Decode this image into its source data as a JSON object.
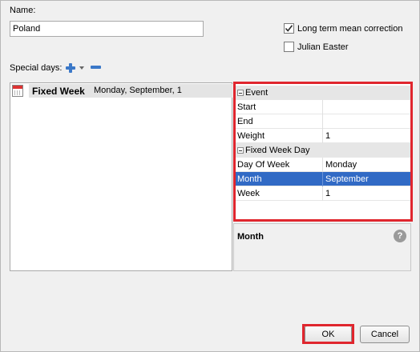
{
  "form": {
    "name_label": "Name:",
    "name_value": "Poland",
    "long_term_label": "Long term mean correction",
    "long_term_checked": true,
    "julian_label": "Julian Easter",
    "julian_checked": false,
    "special_days_label": "Special days:"
  },
  "icons": {
    "add": "plus-icon",
    "add_menu": "chevron-down-icon",
    "remove": "minus-icon",
    "list_item": "calendar-icon",
    "help": "help-icon"
  },
  "special_days": [
    {
      "title": "Fixed Week",
      "detail": "Monday, September, 1"
    }
  ],
  "properties": {
    "categories": [
      {
        "label": "Event",
        "rows": [
          {
            "key": "Start",
            "value": ""
          },
          {
            "key": "End",
            "value": ""
          },
          {
            "key": "Weight",
            "value": "1"
          }
        ]
      },
      {
        "label": "Fixed Week Day",
        "rows": [
          {
            "key": "Day Of Week",
            "value": "Monday"
          },
          {
            "key": "Month",
            "value": "September",
            "selected": true
          },
          {
            "key": "Week",
            "value": "1"
          }
        ]
      }
    ],
    "description_title": "Month",
    "help_glyph": "?"
  },
  "buttons": {
    "ok": "OK",
    "cancel": "Cancel"
  },
  "colors": {
    "selection": "#316ac5",
    "highlight": "#e0262e",
    "accent": "#3b78c8"
  }
}
